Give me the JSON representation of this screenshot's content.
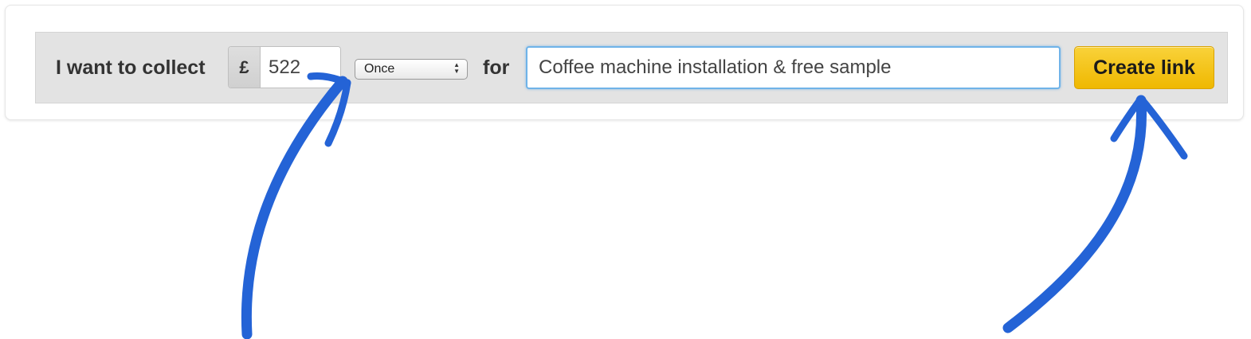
{
  "form": {
    "lead_label": "I want to collect",
    "currency_symbol": "£",
    "amount_value": "522",
    "frequency_selected": "Once",
    "for_label": "for",
    "description_value": "Coffee machine installation & free sample",
    "create_button_label": "Create link"
  },
  "colors": {
    "button_accent": "#f2c21b",
    "focus_ring": "#6fb3e8",
    "annotation_arrow": "#2463d6"
  },
  "annotations": [
    {
      "icon": "hand-drawn-arrow-icon",
      "target": "amount"
    },
    {
      "icon": "hand-drawn-arrow-icon",
      "target": "create-link-button"
    }
  ]
}
